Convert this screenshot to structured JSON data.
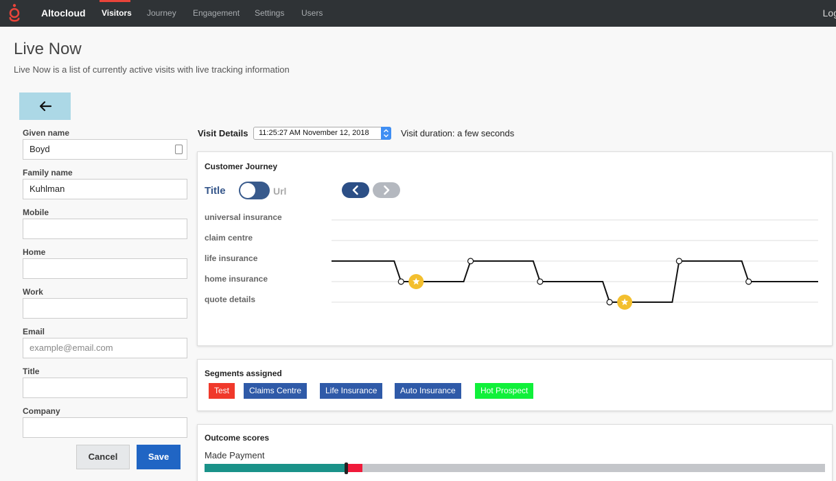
{
  "nav": {
    "brand": "Altocloud",
    "items": [
      "Visitors",
      "Journey",
      "Engagement",
      "Settings",
      "Users"
    ],
    "right": "Log"
  },
  "page": {
    "title": "Live Now",
    "subtitle": "Live Now is a list of currently active visits with live tracking information"
  },
  "form": {
    "fields": [
      {
        "label": "Given name",
        "value": "Boyd",
        "placeholder": ""
      },
      {
        "label": "Family name",
        "value": "Kuhlman",
        "placeholder": ""
      },
      {
        "label": "Mobile",
        "value": "",
        "placeholder": ""
      },
      {
        "label": "Home",
        "value": "",
        "placeholder": ""
      },
      {
        "label": "Work",
        "value": "",
        "placeholder": ""
      },
      {
        "label": "Email",
        "value": "",
        "placeholder": "example@email.com"
      },
      {
        "label": "Title",
        "value": "",
        "placeholder": ""
      },
      {
        "label": "Company",
        "value": "",
        "placeholder": ""
      }
    ],
    "cancel": "Cancel",
    "save": "Save"
  },
  "visit": {
    "label": "Visit Details",
    "selected": "11:25:27 AM November 12, 2018",
    "duration": "Visit duration: a few seconds"
  },
  "journey": {
    "title": "Customer Journey",
    "toggle_left": "Title",
    "toggle_right": "Url",
    "rows": [
      "universal insurance",
      "claim centre",
      "life insurance",
      "home insurance",
      "quote details"
    ],
    "path_levels": [
      2,
      3,
      2,
      3,
      4,
      2,
      3
    ],
    "goal_steps": [
      1,
      4
    ]
  },
  "segments": {
    "title": "Segments assigned",
    "tags": [
      {
        "label": "Test",
        "color": "#f0392b"
      },
      {
        "label": "Claims Centre",
        "color": "#2f5aa8"
      },
      {
        "label": "Life Insurance",
        "color": "#2f5aa8"
      },
      {
        "label": "Auto Insurance",
        "color": "#2f5aa8"
      },
      {
        "label": "Hot Prospect",
        "color": "#10f03a"
      }
    ]
  },
  "outcomes": {
    "title": "Outcome scores",
    "items": [
      {
        "label": "Made Payment",
        "score_fraction": 0.228,
        "band_fraction": 0.254
      }
    ]
  }
}
